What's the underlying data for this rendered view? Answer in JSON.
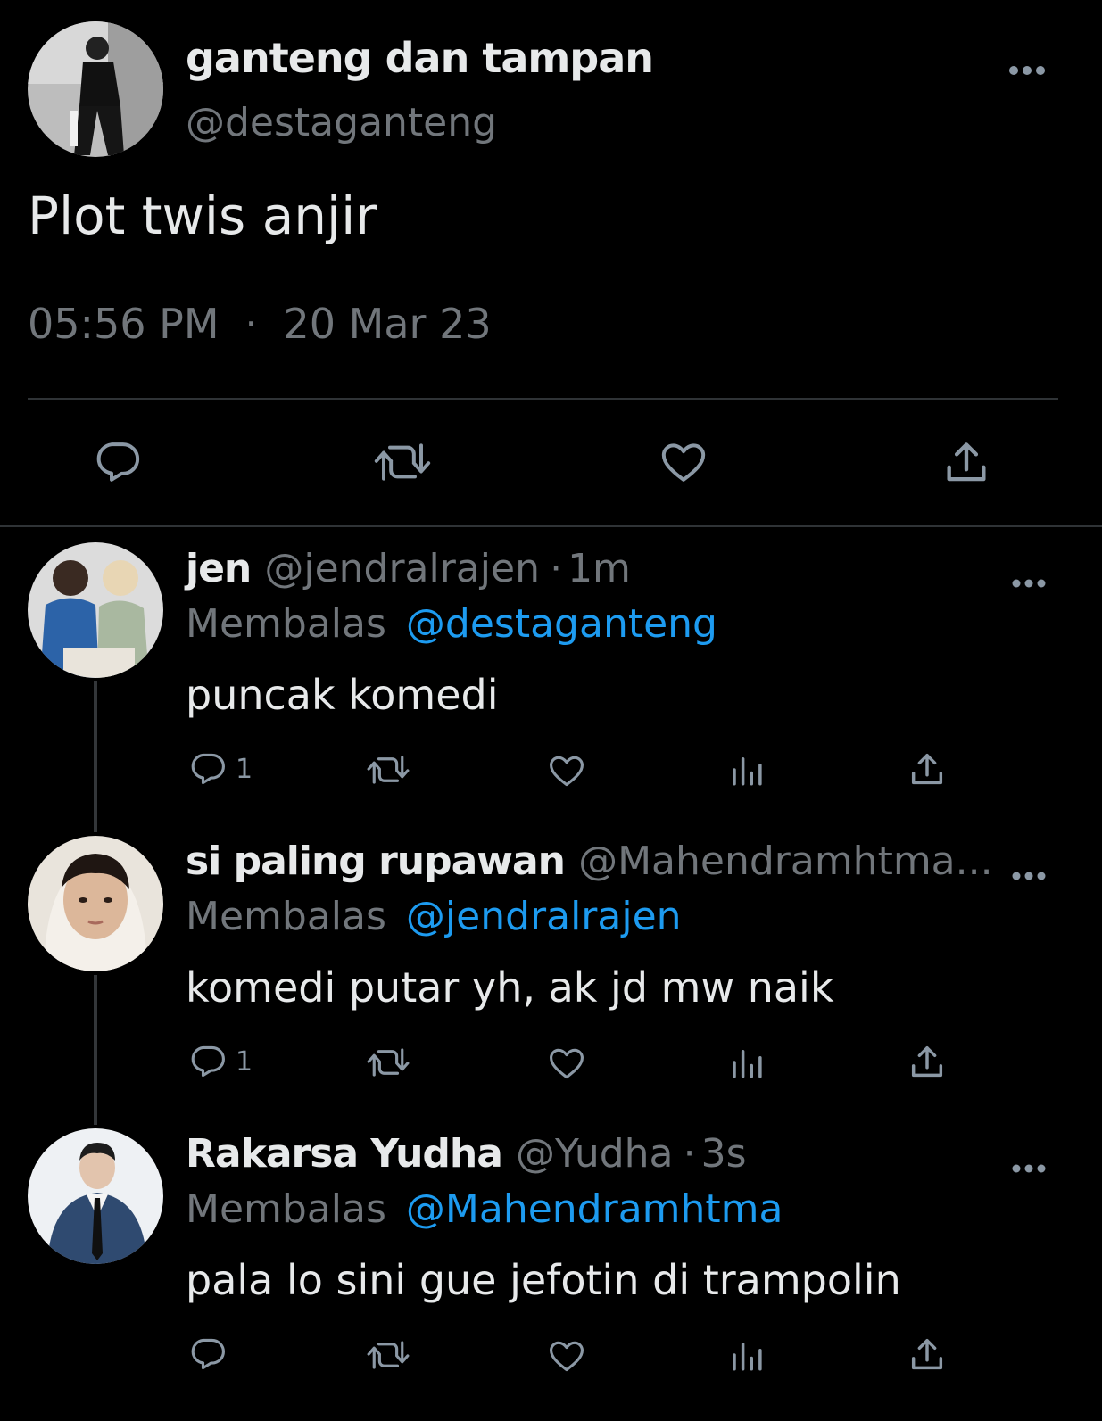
{
  "main_tweet": {
    "display_name": "ganteng dan tampan",
    "handle": "@destaganteng",
    "text": "Plot twis anjir",
    "time": "05:56 PM",
    "separator": "·",
    "date": "20 Mar 23",
    "avatar_icon": "avatar-photo-icon"
  },
  "replies": [
    {
      "display_name": "jen",
      "handle": "@jendralrajen",
      "separator": "·",
      "age": "1m",
      "replying_prefix": "Membalas",
      "replying_to": "@destaganteng",
      "text": "puncak komedi",
      "reply_count": "1"
    },
    {
      "display_name": "si paling rupawan",
      "handle": "@Mahendramhtma...",
      "replying_prefix": "Membalas",
      "replying_to": "@jendralrajen",
      "text": "komedi putar yh, ak jd mw naik",
      "reply_count": "1"
    },
    {
      "display_name": "Rakarsa Yudha",
      "handle": "@Yudha",
      "separator": "·",
      "age": "3s",
      "replying_prefix": "Membalas",
      "replying_to": "@Mahendramhtma",
      "text": "pala lo sini gue jefotin di trampolin",
      "reply_count": ""
    }
  ],
  "icons": {
    "more": "more-horizontal-icon",
    "reply": "reply-icon",
    "retweet": "retweet-icon",
    "like": "like-icon",
    "views": "views-icon",
    "share": "share-icon"
  },
  "colors": {
    "background": "#000000",
    "text": "#e7e9ea",
    "secondary": "#71767b",
    "mention": "#1d9bf0",
    "divider": "#2f3336"
  }
}
